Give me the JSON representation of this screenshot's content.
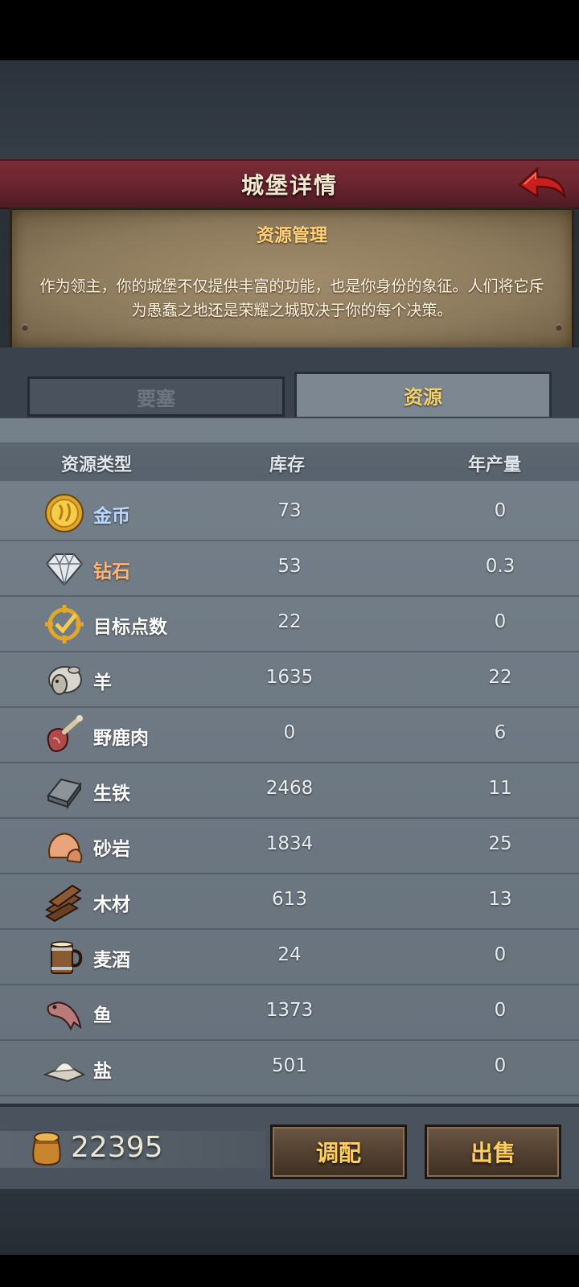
{
  "header": {
    "title": "城堡详情"
  },
  "info": {
    "subtitle": "资源管理",
    "description": "作为领主，你的城堡不仅提供丰富的功能，也是你身份的象征。人们将它斥为愚蠢之地还是荣耀之城取决于你的每个决策。"
  },
  "tabs": [
    {
      "label": "要塞",
      "active": false
    },
    {
      "label": "资源",
      "active": true
    }
  ],
  "table": {
    "columns": [
      "资源类型",
      "库存",
      "年产量"
    ],
    "rows": [
      {
        "name": "金币",
        "stock": "73",
        "production": "0",
        "icon": "gold-coin-icon"
      },
      {
        "name": "钻石",
        "stock": "53",
        "production": "0.3",
        "icon": "diamond-icon"
      },
      {
        "name": "目标点数",
        "stock": "22",
        "production": "0",
        "icon": "target-points-icon"
      },
      {
        "name": "羊",
        "stock": "1635",
        "production": "22",
        "icon": "sheep-icon"
      },
      {
        "name": "野鹿肉",
        "stock": "0",
        "production": "6",
        "icon": "venison-icon"
      },
      {
        "name": "生铁",
        "stock": "2468",
        "production": "11",
        "icon": "iron-icon"
      },
      {
        "name": "砂岩",
        "stock": "1834",
        "production": "25",
        "icon": "sandstone-icon"
      },
      {
        "name": "木材",
        "stock": "613",
        "production": "13",
        "icon": "wood-icon"
      },
      {
        "name": "麦酒",
        "stock": "24",
        "production": "0",
        "icon": "ale-icon"
      },
      {
        "name": "鱼",
        "stock": "1373",
        "production": "0",
        "icon": "fish-icon"
      },
      {
        "name": "盐",
        "stock": "501",
        "production": "0",
        "icon": "salt-icon"
      }
    ]
  },
  "footer": {
    "money": "22395",
    "allocate_label": "调配",
    "sell_label": "出售"
  },
  "colors": {
    "header_red": "#6a2530",
    "gold_text": "#ffcf5e",
    "panel_parchment": "#8c7a5c"
  }
}
